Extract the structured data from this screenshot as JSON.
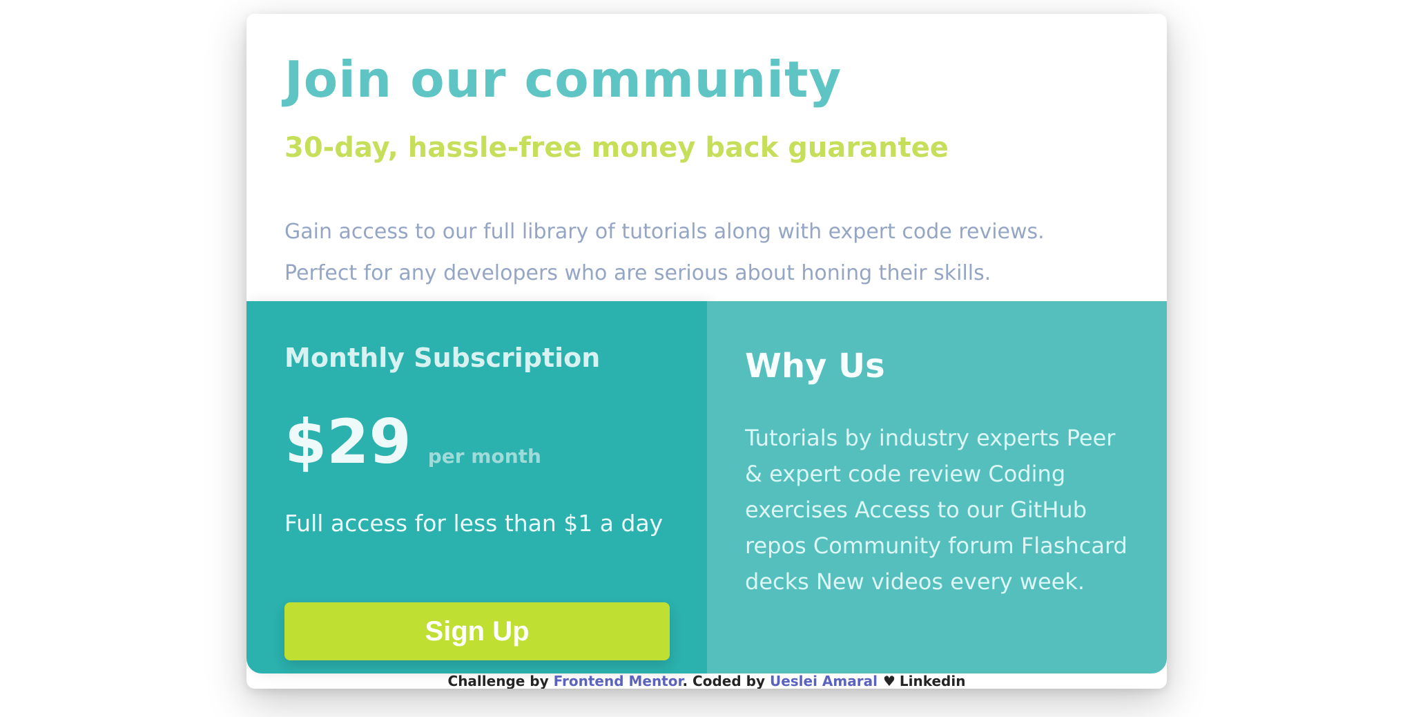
{
  "hero": {
    "title": "Join our community",
    "subtitle": "30-day, hassle-free money back guarantee",
    "description": "Gain access to our full library of tutorials along with expert code reviews. Perfect for any developers who are serious about honing their skills."
  },
  "subscription": {
    "label": "Monthly Subscription",
    "price": "$29",
    "period": "per month",
    "note": "Full access for less than $1 a day",
    "button": "Sign Up"
  },
  "why_us": {
    "title": "Why Us",
    "text": "Tutorials by industry experts Peer & expert code review Coding exercises Access to our GitHub repos Community forum Flashcard decks New videos every week."
  },
  "footer": {
    "prefix": "Challenge by ",
    "challenge_link": "Frontend Mentor",
    "middle": ". Coded by ",
    "author_link": "Ueslei Amaral",
    "heart": "♥",
    "linkedin": "Linkedin"
  },
  "colors": {
    "title": "#5ec5c4",
    "subtitle": "#c6df5a",
    "description": "#95a6c5",
    "left_panel": "#2bb1ae",
    "right_panel": "#54bfbd",
    "button": "#bfe032",
    "footer_link": "#5b63bf"
  }
}
